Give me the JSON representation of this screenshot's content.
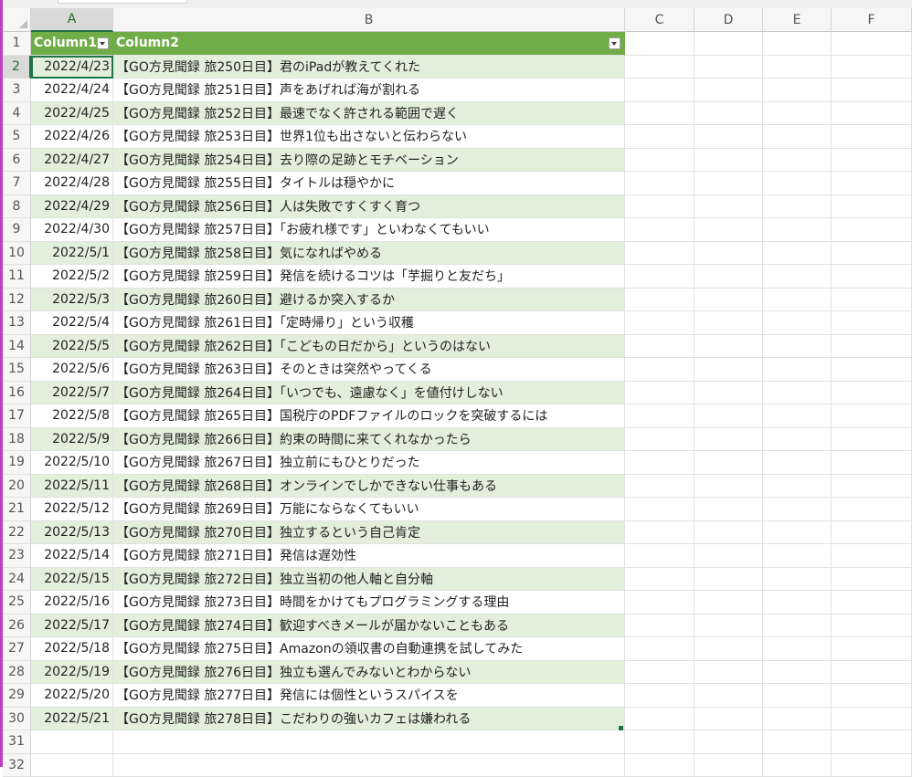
{
  "columns": [
    "A",
    "B",
    "C",
    "D",
    "E",
    "F"
  ],
  "header": {
    "row_number": "1",
    "col1": "Column1",
    "col2": "Column2"
  },
  "rows": [
    {
      "n": "2",
      "date": "2022/4/23",
      "title": "【GO方見聞録 旅250日目】君のiPadが教えてくれた"
    },
    {
      "n": "3",
      "date": "2022/4/24",
      "title": "【GO方見聞録 旅251日目】声をあげれば海が割れる"
    },
    {
      "n": "4",
      "date": "2022/4/25",
      "title": "【GO方見聞録 旅252日目】最速でなく許される範囲で遅く"
    },
    {
      "n": "5",
      "date": "2022/4/26",
      "title": "【GO方見聞録 旅253日目】世界1位も出さないと伝わらない"
    },
    {
      "n": "6",
      "date": "2022/4/27",
      "title": "【GO方見聞録 旅254日目】去り際の足跡とモチベーション"
    },
    {
      "n": "7",
      "date": "2022/4/28",
      "title": "【GO方見聞録 旅255日目】タイトルは穏やかに"
    },
    {
      "n": "8",
      "date": "2022/4/29",
      "title": "【GO方見聞録 旅256日目】人は失敗ですくすく育つ"
    },
    {
      "n": "9",
      "date": "2022/4/30",
      "title": "【GO方見聞録 旅257日目】「お疲れ様です」といわなくてもいい"
    },
    {
      "n": "10",
      "date": "2022/5/1",
      "title": "【GO方見聞録 旅258日目】気になればやめる"
    },
    {
      "n": "11",
      "date": "2022/5/2",
      "title": "【GO方見聞録 旅259日目】発信を続けるコツは「芋掘りと友だち」"
    },
    {
      "n": "12",
      "date": "2022/5/3",
      "title": "【GO方見聞録 旅260日目】避けるか突入するか"
    },
    {
      "n": "13",
      "date": "2022/5/4",
      "title": "【GO方見聞録 旅261日目】「定時帰り」という収穫"
    },
    {
      "n": "14",
      "date": "2022/5/5",
      "title": "【GO方見聞録 旅262日目】「こどもの日だから」というのはない"
    },
    {
      "n": "15",
      "date": "2022/5/6",
      "title": "【GO方見聞録 旅263日目】そのときは突然やってくる"
    },
    {
      "n": "16",
      "date": "2022/5/7",
      "title": "【GO方見聞録 旅264日目】「いつでも、遠慮なく」を値付けしない"
    },
    {
      "n": "17",
      "date": "2022/5/8",
      "title": "【GO方見聞録 旅265日目】国税庁のPDFファイルのロックを突破するには"
    },
    {
      "n": "18",
      "date": "2022/5/9",
      "title": "【GO方見聞録 旅266日目】約束の時間に来てくれなかったら"
    },
    {
      "n": "19",
      "date": "2022/5/10",
      "title": "【GO方見聞録 旅267日目】独立前にもひとりだった"
    },
    {
      "n": "20",
      "date": "2022/5/11",
      "title": "【GO方見聞録 旅268日目】オンラインでしかできない仕事もある"
    },
    {
      "n": "21",
      "date": "2022/5/12",
      "title": "【GO方見聞録 旅269日目】万能にならなくてもいい"
    },
    {
      "n": "22",
      "date": "2022/5/13",
      "title": "【GO方見聞録 旅270日目】独立するという自己肯定"
    },
    {
      "n": "23",
      "date": "2022/5/14",
      "title": "【GO方見聞録 旅271日目】発信は遅効性"
    },
    {
      "n": "24",
      "date": "2022/5/15",
      "title": "【GO方見聞録 旅272日目】独立当初の他人軸と自分軸"
    },
    {
      "n": "25",
      "date": "2022/5/16",
      "title": "【GO方見聞録 旅273日目】時間をかけてもプログラミングする理由"
    },
    {
      "n": "26",
      "date": "2022/5/17",
      "title": "【GO方見聞録 旅274日目】歓迎すべきメールが届かないこともある"
    },
    {
      "n": "27",
      "date": "2022/5/18",
      "title": "【GO方見聞録 旅275日目】Amazonの領収書の自動連携を試してみた"
    },
    {
      "n": "28",
      "date": "2022/5/19",
      "title": "【GO方見聞録 旅276日目】独立も選んでみないとわからない"
    },
    {
      "n": "29",
      "date": "2022/5/20",
      "title": "【GO方見聞録 旅277日目】発信には個性というスパイスを"
    },
    {
      "n": "30",
      "date": "2022/5/21",
      "title": "【GO方見聞録 旅278日目】こだわりの強いカフェは嫌われる"
    }
  ],
  "empty_rows": [
    "31",
    "32"
  ],
  "colors": {
    "table_header": "#70ad47",
    "band": "#e2efda",
    "selection": "#217346"
  }
}
